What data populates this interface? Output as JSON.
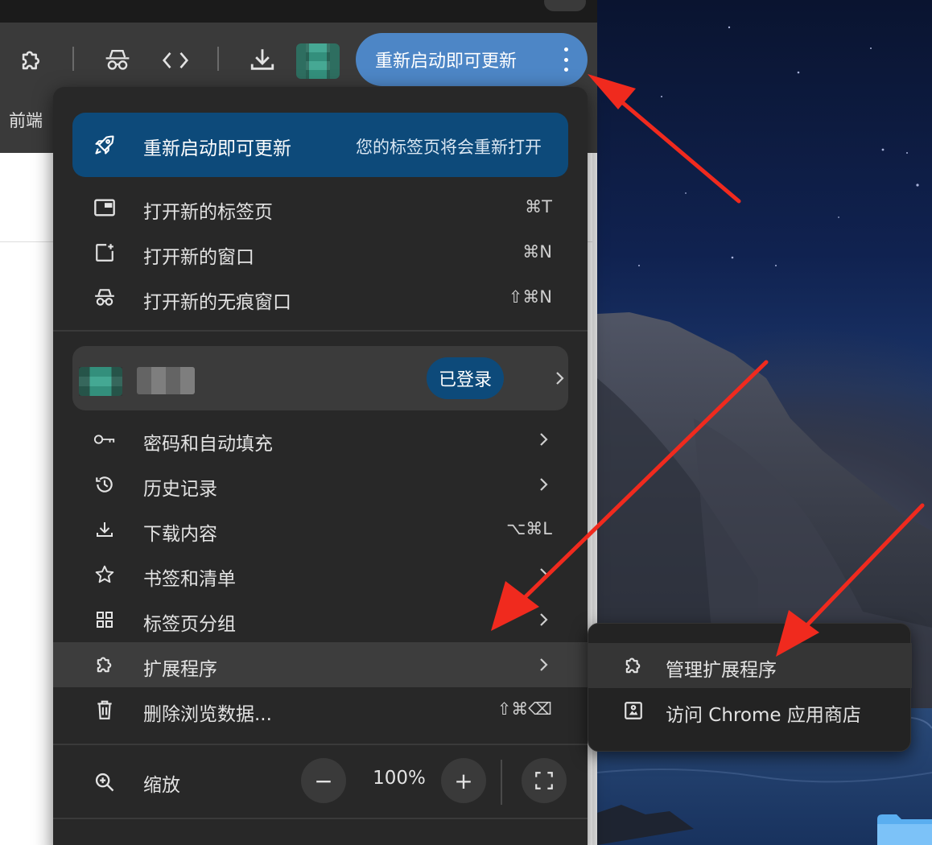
{
  "toolbar": {
    "update_pill_label": "重新启动即可更新",
    "icons": [
      "extension-icon",
      "incognito-icon",
      "code-icon",
      "download-icon",
      "more-vert-icon"
    ]
  },
  "bookmarks_bar": {
    "item": "前端"
  },
  "menu": {
    "update_banner": {
      "title": "重新启动即可更新",
      "subtitle": "您的标签页将会重新打开"
    },
    "items_top": [
      {
        "label": "打开新的标签页",
        "shortcut": "⌘T",
        "icon": "new-tab-icon"
      },
      {
        "label": "打开新的窗口",
        "shortcut": "⌘N",
        "icon": "new-window-icon"
      },
      {
        "label": "打开新的无痕窗口",
        "shortcut": "⇧⌘N",
        "icon": "incognito-icon"
      }
    ],
    "profile": {
      "status": "已登录"
    },
    "items_mid": [
      {
        "label": "密码和自动填充",
        "shortcut": "",
        "icon": "key-icon",
        "submenu": true
      },
      {
        "label": "历史记录",
        "shortcut": "",
        "icon": "history-icon",
        "submenu": true
      },
      {
        "label": "下载内容",
        "shortcut": "⌥⌘L",
        "icon": "download-icon",
        "submenu": false
      },
      {
        "label": "书签和清单",
        "shortcut": "",
        "icon": "star-icon",
        "submenu": true
      },
      {
        "label": "标签页分组",
        "shortcut": "",
        "icon": "grid-icon",
        "submenu": true
      },
      {
        "label": "扩展程序",
        "shortcut": "",
        "icon": "extension-icon",
        "submenu": true,
        "highlighted": true
      },
      {
        "label": "删除浏览数据...",
        "shortcut": "⇧⌘⌫",
        "icon": "trash-icon",
        "submenu": false
      }
    ],
    "zoom": {
      "label": "缩放",
      "minus": "−",
      "value": "100%",
      "plus": "+"
    }
  },
  "extensions_submenu": {
    "items": [
      {
        "label": "管理扩展程序",
        "icon": "extension-icon",
        "highlighted": true
      },
      {
        "label": "访问 Chrome 应用商店",
        "icon": "web-store-icon"
      }
    ]
  },
  "colors": {
    "menu_bg": "#282828",
    "accent_banner": "#0d4a7a",
    "update_pill": "#4d86c6",
    "annotation_arrow": "#f02a1e"
  }
}
